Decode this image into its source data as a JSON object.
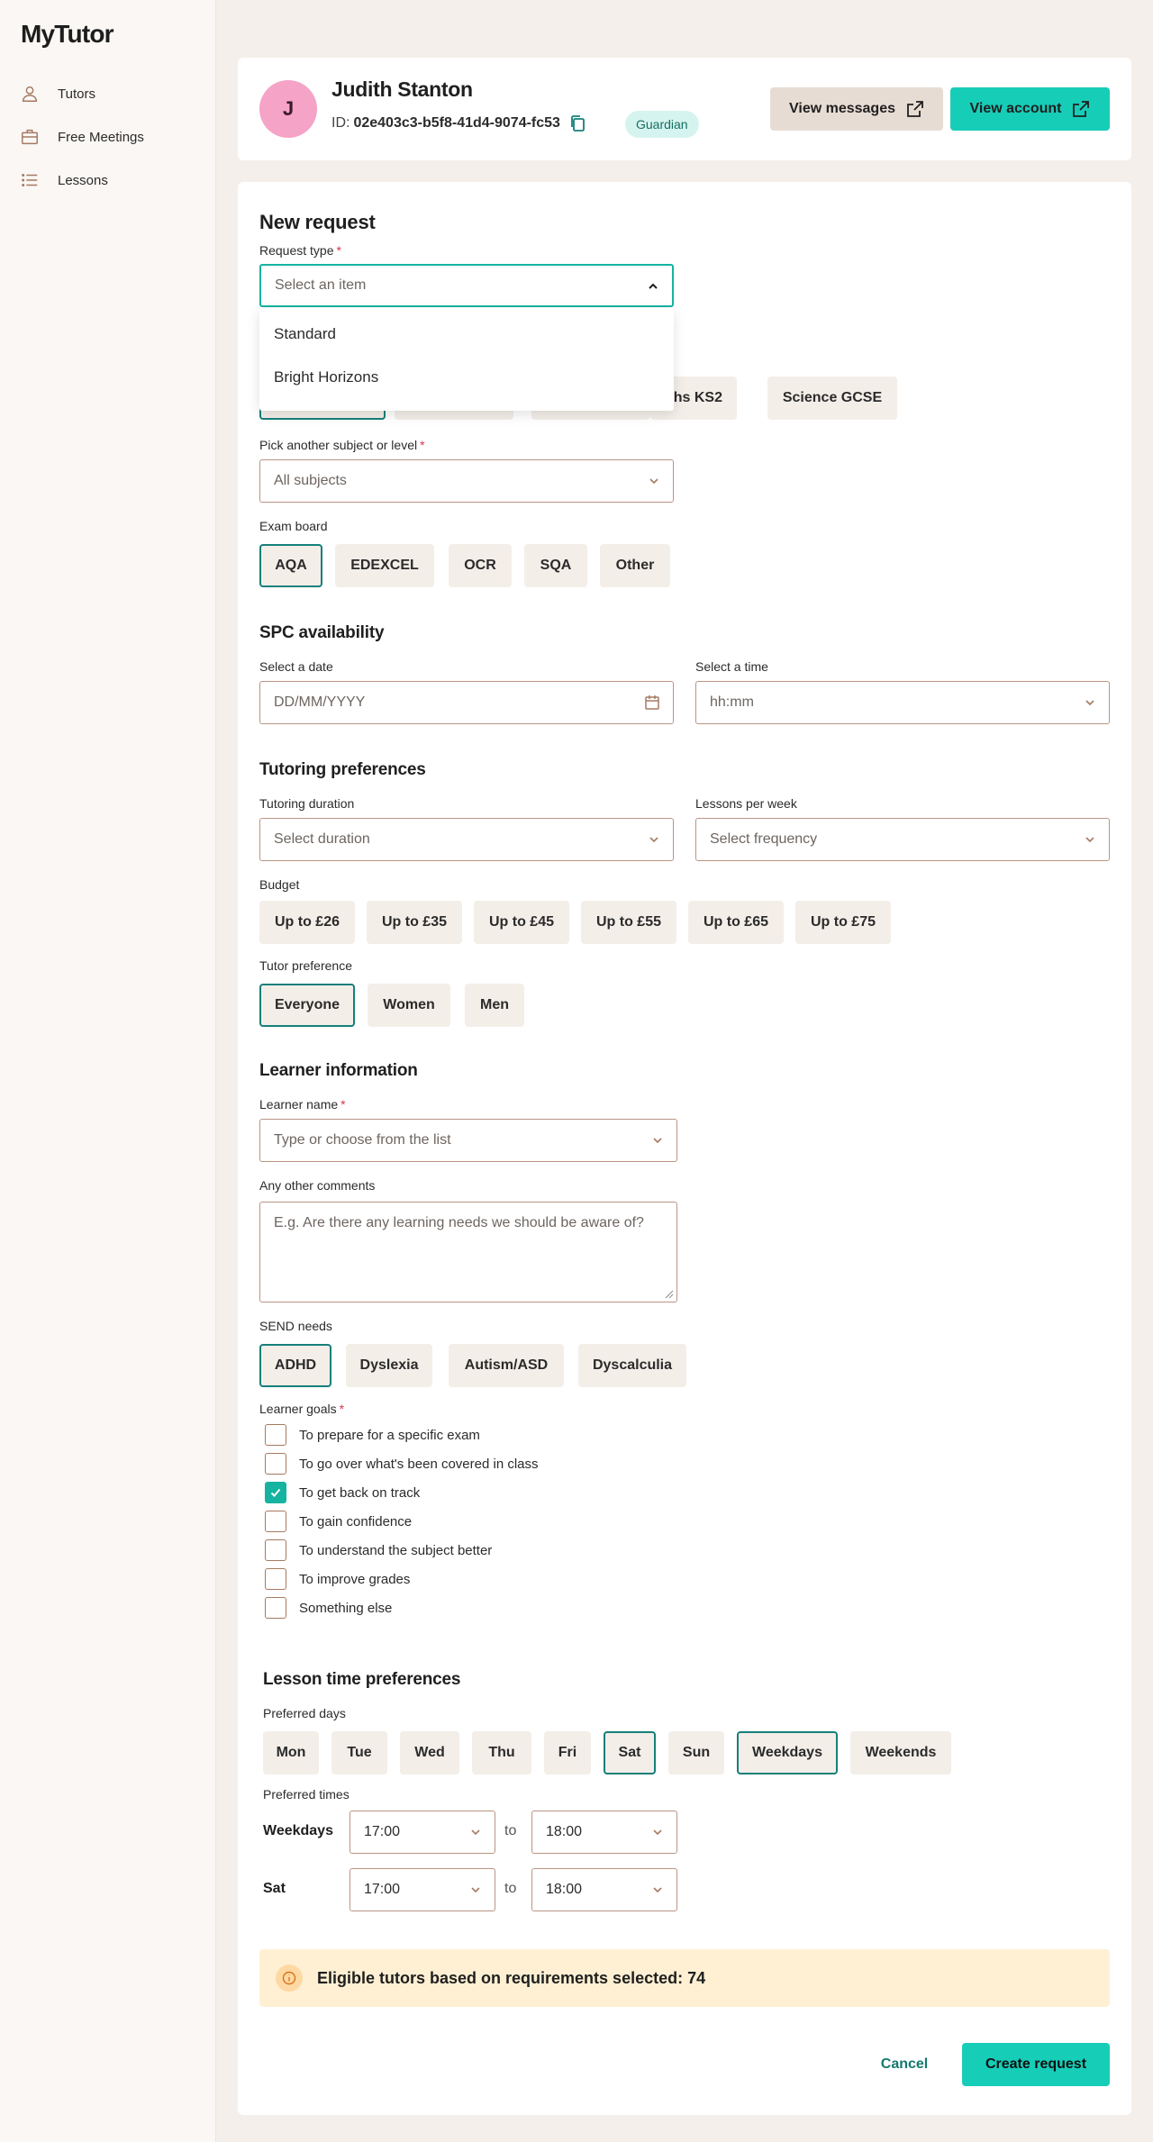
{
  "app": {
    "logo": "MyTutor"
  },
  "sidebar": {
    "items": [
      {
        "label": "Tutors",
        "icon": "person-icon"
      },
      {
        "label": "Free Meetings",
        "icon": "briefcase-icon"
      },
      {
        "label": "Lessons",
        "icon": "list-icon"
      }
    ]
  },
  "profile": {
    "initial": "J",
    "name": "Judith Stanton",
    "id_label": "ID:",
    "id_value": "02e403c3-b5f8-41d4-9074-fc53",
    "role_badge": "Guardian",
    "view_messages": "View messages",
    "view_account": "View account"
  },
  "form": {
    "title": "New request",
    "request_type": {
      "label": "Request type",
      "placeholder": "Select an item",
      "options": [
        "Standard",
        "Bright Horizons"
      ]
    },
    "subject_chips": [
      "",
      "",
      "",
      "Maths KS2",
      "Science GCSE"
    ],
    "subject_chips_visible": [
      "aths KS2",
      "Science GCSE"
    ],
    "subject_select": {
      "label": "Pick another subject or level",
      "value": "All subjects"
    },
    "exam_board": {
      "label": "Exam board",
      "options": [
        "AQA",
        "EDEXCEL",
        "OCR",
        "SQA",
        "Other"
      ],
      "selected": "AQA"
    },
    "spc": {
      "title": "SPC availability",
      "date_label": "Select a date",
      "date_placeholder": "DD/MM/YYYY",
      "time_label": "Select a time",
      "time_placeholder": "hh:mm"
    },
    "tutoring": {
      "title": "Tutoring preferences",
      "duration_label": "Tutoring duration",
      "duration_placeholder": "Select duration",
      "frequency_label": "Lessons per week",
      "frequency_placeholder": "Select frequency",
      "budget_label": "Budget",
      "budget_options": [
        "Up to £26",
        "Up to £35",
        "Up to £45",
        "Up to £55",
        "Up to £65",
        "Up to £75"
      ],
      "tutor_pref_label": "Tutor preference",
      "tutor_pref_options": [
        "Everyone",
        "Women",
        "Men"
      ],
      "tutor_pref_selected": "Everyone"
    },
    "learner": {
      "title": "Learner information",
      "name_label": "Learner name",
      "name_placeholder": "Type or choose from the list",
      "comments_label": "Any other comments",
      "comments_placeholder": "E.g. Are there any learning needs we should be aware of?",
      "send_label": "SEND needs",
      "send_options": [
        "ADHD",
        "Dyslexia",
        "Autism/ASD",
        "Dyscalculia"
      ],
      "send_selected": "ADHD",
      "goals_label": "Learner goals",
      "goals": [
        {
          "label": "To prepare for a specific exam",
          "checked": false
        },
        {
          "label": "To go over what's been covered in class",
          "checked": false
        },
        {
          "label": "To get back on track",
          "checked": true
        },
        {
          "label": "To gain confidence",
          "checked": false
        },
        {
          "label": "To understand the subject better",
          "checked": false
        },
        {
          "label": "To improve grades",
          "checked": false
        },
        {
          "label": "Something else",
          "checked": false
        }
      ]
    },
    "lesson_time": {
      "title": "Lesson time preferences",
      "days_label": "Preferred days",
      "days": [
        "Mon",
        "Tue",
        "Wed",
        "Thu",
        "Fri",
        "Sat",
        "Sun",
        "Weekdays",
        "Weekends"
      ],
      "days_selected": [
        "Sat",
        "Weekdays"
      ],
      "times_label": "Preferred times",
      "to_label": "to",
      "rows": [
        {
          "label": "Weekdays",
          "from": "17:00",
          "to": "18:00"
        },
        {
          "label": "Sat",
          "from": "17:00",
          "to": "18:00"
        }
      ]
    },
    "banner": "Eligible tutors based on requirements selected: 74",
    "cancel": "Cancel",
    "create": "Create request"
  },
  "colors": {
    "accent": "#16cdb8",
    "selected_border": "#15807a",
    "banner_bg": "#fff0d3",
    "badge_bg": "#d6f4ef"
  }
}
